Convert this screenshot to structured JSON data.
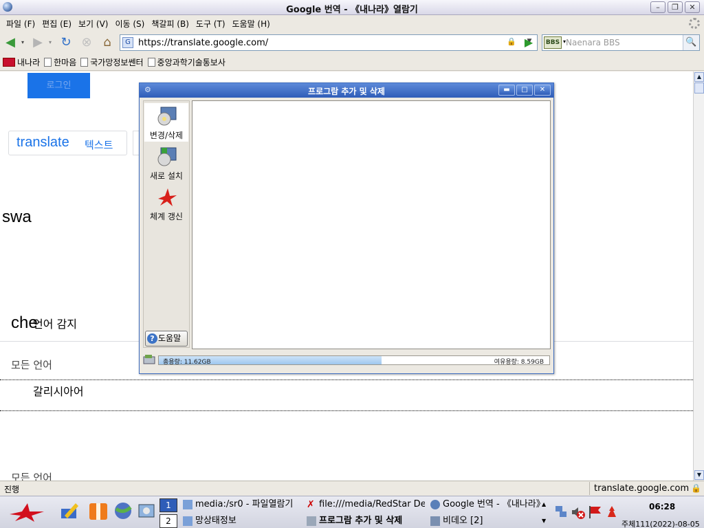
{
  "window": {
    "title": "Google 번역 - 《내나라》열람기"
  },
  "menubar": [
    "파일 (F)",
    "편집 (E)",
    "보기 (V)",
    "이동 (S)",
    "책갈피 (B)",
    "도구 (T)",
    "도움말 (H)"
  ],
  "navbar": {
    "url": "https://translate.google.com/",
    "search_placeholder": "Naenara BBS",
    "search_engine": "BBS"
  },
  "bookmarks": [
    "내나라",
    "한마음",
    "국가망정보쎈터",
    "중앙과학기술통보사"
  ],
  "page": {
    "blue_button": "로그인",
    "tab_main": "translate",
    "tab_sub": "텍스트",
    "swa": "swa",
    "che": "che",
    "detect_language": "언어 감지",
    "all_languages_1": "모든 언어",
    "galician": "갈리시아어",
    "all_languages_2": "모든 언어"
  },
  "statusbar": {
    "left": "진행",
    "right": "translate.google.com"
  },
  "dialog": {
    "title": "프로그람 추가 및 삭제",
    "sidebar": [
      {
        "label": "변경/삭제",
        "icon": "cd-monitor-icon"
      },
      {
        "label": "새로 설치",
        "icon": "install-icon"
      },
      {
        "label": "체계 갱신",
        "icon": "red-star-update-icon"
      }
    ],
    "help_label": "도움말",
    "disk_used": "총용량: 11.62GB",
    "disk_free": "여유용량: 8.59GB",
    "disk_used_fraction": 0.57
  },
  "taskbar": {
    "pager": [
      "1",
      "2"
    ],
    "tasks_top": [
      "media:/sr0 - 파일열람기",
      "file:///media/RedStar De",
      "Google 번역 - 《내나라》"
    ],
    "tasks_bottom": [
      "망상태정보",
      "프로그람 추가 및 삭제",
      "비데오 [2]"
    ],
    "clock": "06:28",
    "date": "주체111(2022)-08-05"
  },
  "colors": {
    "accent": "#1a73e8",
    "dialog_title": "#2f5db8",
    "taskbar": "#d2d4e0"
  }
}
